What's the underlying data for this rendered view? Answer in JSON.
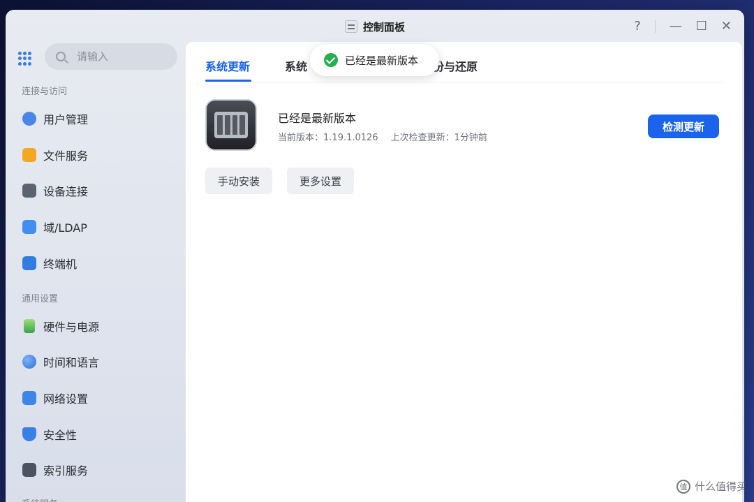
{
  "window": {
    "title": "控制面板"
  },
  "window_controls": {
    "help": "?",
    "minimize": "—",
    "maximize": "☐",
    "close": "✕"
  },
  "search": {
    "placeholder": "请输入"
  },
  "sidebar": {
    "sections": [
      {
        "label": "连接与访问"
      },
      {
        "label": "通用设置"
      },
      {
        "label": "系统服务"
      }
    ],
    "items": [
      {
        "label": "用户管理",
        "icon": "user-management-icon"
      },
      {
        "label": "文件服务",
        "icon": "folder-icon"
      },
      {
        "label": "设备连接",
        "icon": "device-icon"
      },
      {
        "label": "域/LDAP",
        "icon": "id-card-icon"
      },
      {
        "label": "终端机",
        "icon": "terminal-icon"
      },
      {
        "label": "硬件与电源",
        "icon": "battery-icon"
      },
      {
        "label": "时间和语言",
        "icon": "globe-icon"
      },
      {
        "label": "网络设置",
        "icon": "router-icon"
      },
      {
        "label": "安全性",
        "icon": "shield-icon"
      },
      {
        "label": "索引服务",
        "icon": "index-icon"
      }
    ]
  },
  "tabs": [
    {
      "label": "系统更新",
      "active": true
    },
    {
      "label": "系统",
      "active": false
    },
    {
      "label": "份与还原",
      "active": false
    }
  ],
  "update": {
    "status_title": "已经是最新版本",
    "current_version_label": "当前版本：",
    "current_version": "1.19.1.0126",
    "last_check_label": "上次检查更新：",
    "last_check": "1分钟前",
    "check_button": "检测更新",
    "manual_install_button": "手动安装",
    "more_settings_button": "更多设置"
  },
  "toast": {
    "message": "已经是最新版本"
  },
  "watermark": {
    "badge": "值",
    "text": "什么值得买"
  },
  "colors": {
    "accent": "#1a63ea",
    "success": "#27ae4d"
  }
}
